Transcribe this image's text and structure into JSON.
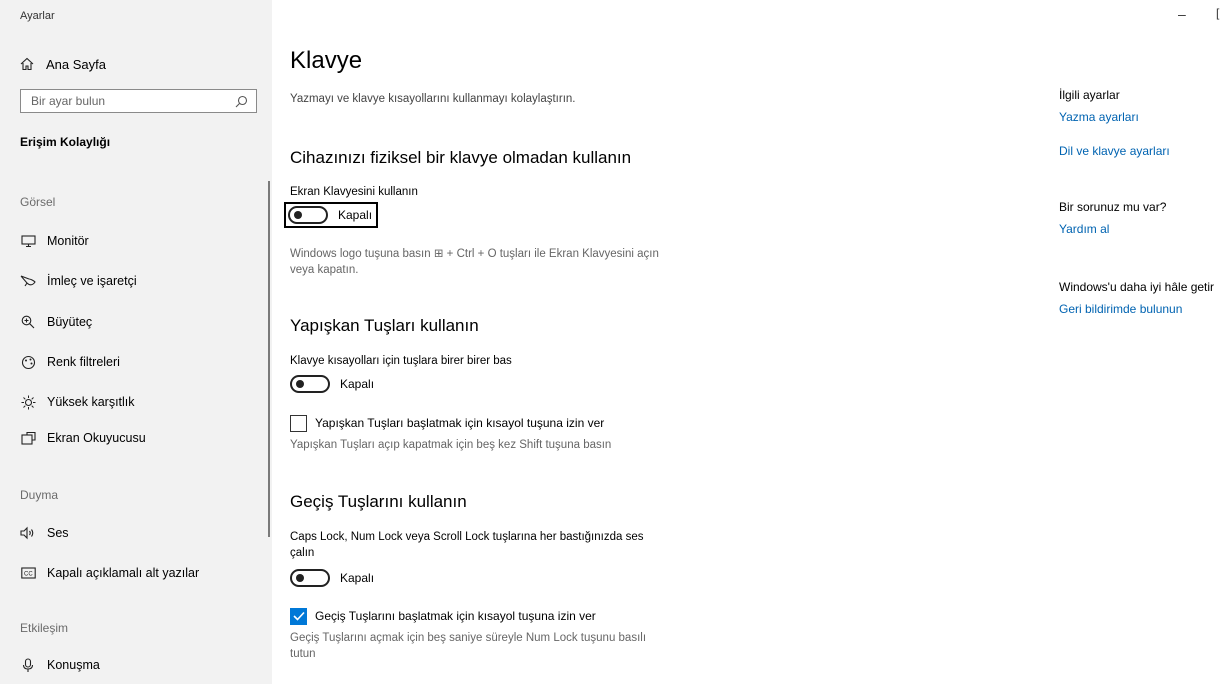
{
  "window": {
    "title": "Ayarlar",
    "minimize_glyph": "–",
    "maximize_glyph": "["
  },
  "sidebar": {
    "home": {
      "label": "Ana Sayfa",
      "icon": "home-icon"
    },
    "search": {
      "placeholder": "Bir ayar bulun",
      "value": ""
    },
    "current_section": "Erişim Kolaylığı",
    "groups": [
      {
        "label": "Görsel",
        "items": [
          {
            "label": "Monitör",
            "icon": "monitor-icon"
          },
          {
            "label": "İmleç ve işaretçi",
            "icon": "pointer-icon"
          },
          {
            "label": "Büyüteç",
            "icon": "magnifier-icon"
          },
          {
            "label": "Renk filtreleri",
            "icon": "color-filter-icon"
          },
          {
            "label": "Yüksek karşıtlık",
            "icon": "high-contrast-icon"
          },
          {
            "label": "Ekran Okuyucusu",
            "icon": "narrator-icon"
          }
        ]
      },
      {
        "label": "Duyma",
        "items": [
          {
            "label": "Ses",
            "icon": "speaker-icon"
          },
          {
            "label": "Kapalı açıklamalı alt yazılar",
            "icon": "closed-caption-icon"
          }
        ]
      },
      {
        "label": "Etkileşim",
        "items": [
          {
            "label": "Konuşma",
            "icon": "microphone-icon"
          }
        ]
      }
    ]
  },
  "main": {
    "title": "Klavye",
    "description": "Yazmayı ve klavye kısayollarını kullanmayı kolaylaştırın.",
    "on_screen_keyboard": {
      "heading": "Cihazınızı fiziksel bir klavye olmadan kullanın",
      "toggle_label": "Ekran Klavyesini kullanın",
      "toggle_state": "Kapalı",
      "hint": "Windows logo tuşuna basın ⊞ + Ctrl + O tuşları ile Ekran Klavyesini açın veya kapatın."
    },
    "sticky_keys": {
      "heading": "Yapışkan Tuşları kullanın",
      "toggle_label": "Klavye kısayolları için tuşlara birer birer bas",
      "toggle_state": "Kapalı",
      "checkbox_label": "Yapışkan Tuşları başlatmak için kısayol tuşuna izin ver",
      "checkbox_checked": false,
      "hint": "Yapışkan Tuşları açıp kapatmak için beş kez Shift tuşuna basın"
    },
    "toggle_keys": {
      "heading": "Geçiş Tuşlarını kullanın",
      "toggle_label": "Caps Lock, Num Lock veya Scroll Lock tuşlarına her bastığınızda ses çalın",
      "toggle_state": "Kapalı",
      "checkbox_label": "Geçiş Tuşlarını başlatmak için kısayol tuşuna izin ver",
      "checkbox_checked": true,
      "hint": "Geçiş Tuşlarını açmak için beş saniye süreyle Num Lock tuşunu basılı tutun"
    }
  },
  "right_column": {
    "related_heading": "İlgili ayarlar",
    "related_links": [
      "Yazma ayarları",
      "Dil ve klavye ayarları"
    ],
    "help_heading": "Bir sorunuz mu var?",
    "help_link": "Yardım al",
    "feedback_heading": "Windows'u daha iyi hâle getir",
    "feedback_link": "Geri bildirimde bulunun"
  },
  "colors": {
    "sidebar_bg": "#f2f2f2",
    "link": "#0063b1",
    "accent": "#0078d7"
  }
}
